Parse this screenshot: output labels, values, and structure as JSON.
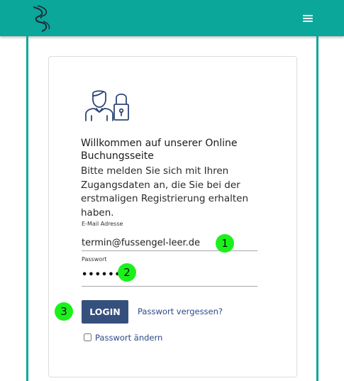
{
  "header": {
    "logo_icon": "swirl-logo-icon",
    "menu_icon": "hamburger-menu-icon",
    "accent_color": "#0aa79a"
  },
  "login": {
    "icon": "user-lock-icon",
    "title": "Willkommen auf unserer Online Buchungsseite",
    "intro": "Bitte melden Sie sich mit Ihren Zugangsdaten an, die Sie bei der erstmaligen Registrierung erhalten haben.",
    "email_label": "E-Mail Adresse",
    "email_value": "termin@fussengel-leer.de",
    "password_label": "Passwort",
    "password_masked": "••••••",
    "login_button": "LOGIN",
    "forgot_link": "Passwort vergessen?",
    "change_password_label": "Passwort ändern",
    "button_color": "#36507e"
  },
  "annotations": {
    "marker_1": "1",
    "marker_2": "2",
    "marker_3": "3",
    "marker_color": "#1cf01c"
  }
}
